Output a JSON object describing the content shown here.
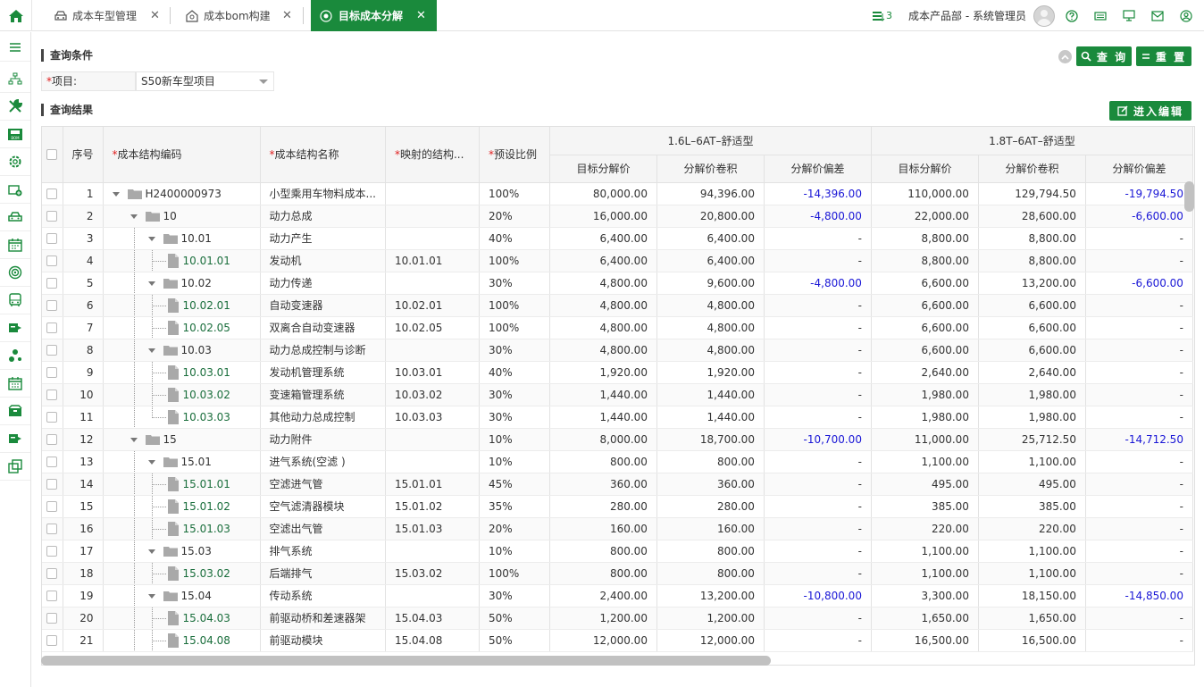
{
  "tabs": [
    {
      "label": "成本车型管理",
      "icon": "car-icon"
    },
    {
      "label": "成本bom构建",
      "icon": "bom-icon"
    },
    {
      "label": "目标成本分解",
      "icon": "target-icon",
      "active": true
    }
  ],
  "tab_close": "✕",
  "header": {
    "badge_count": "3",
    "user_label": "成本产品部 - 系统管理员"
  },
  "query": {
    "section_title": "查询条件",
    "project_label": "项目:",
    "project_required": "*",
    "project_value": "S50新车型项目",
    "query_button": "查 询",
    "reset_button": "重 置"
  },
  "result": {
    "section_title": "查询结果",
    "edit_button": "进入编辑"
  },
  "table": {
    "columns": {
      "seq": "序号",
      "code": "成本结构编码",
      "name": "成本结构名称",
      "mapped": "映射的结构...",
      "ratio": "预设比例",
      "target": "目标分解价",
      "roll": "分解价卷积",
      "dev": "分解价偏差"
    },
    "required_mark": "*",
    "groups": [
      "1.6L–6AT–舒适型",
      "1.8T–6AT–舒适型"
    ],
    "rows": [
      {
        "seq": "1",
        "code": "H2400000973",
        "level": 0,
        "type": "folder",
        "last": true,
        "name": "小型乘用车物料成本...",
        "mapped": "",
        "ratio": "100%",
        "t1": "80,000.00",
        "r1": "94,396.00",
        "d1": "-14,396.00",
        "d1b": true,
        "t2": "110,000.00",
        "r2": "129,794.50",
        "d2": "-19,794.50",
        "d2b": true
      },
      {
        "seq": "2",
        "code": "10",
        "level": 1,
        "type": "folder",
        "last": false,
        "name": "动力总成",
        "mapped": "",
        "ratio": "20%",
        "t1": "16,000.00",
        "r1": "20,800.00",
        "d1": "-4,800.00",
        "d1b": true,
        "t2": "22,000.00",
        "r2": "28,600.00",
        "d2": "-6,600.00",
        "d2b": true
      },
      {
        "seq": "3",
        "code": "10.01",
        "level": 2,
        "type": "folder",
        "last": false,
        "name": "动力产生",
        "mapped": "",
        "ratio": "40%",
        "t1": "6,400.00",
        "r1": "6,400.00",
        "d1": "-",
        "t2": "8,800.00",
        "r2": "8,800.00",
        "d2": "-"
      },
      {
        "seq": "4",
        "code": "10.01.01",
        "level": 3,
        "type": "doc",
        "last": true,
        "name": "发动机",
        "mapped": "10.01.01",
        "ratio": "100%",
        "t1": "6,400.00",
        "r1": "6,400.00",
        "d1": "-",
        "t2": "8,800.00",
        "r2": "8,800.00",
        "d2": "-"
      },
      {
        "seq": "5",
        "code": "10.02",
        "level": 2,
        "type": "folder",
        "last": false,
        "name": "动力传递",
        "mapped": "",
        "ratio": "30%",
        "t1": "4,800.00",
        "r1": "9,600.00",
        "d1": "-4,800.00",
        "d1b": true,
        "t2": "6,600.00",
        "r2": "13,200.00",
        "d2": "-6,600.00",
        "d2b": true
      },
      {
        "seq": "6",
        "code": "10.02.01",
        "level": 3,
        "type": "doc",
        "last": false,
        "name": "自动变速器",
        "mapped": "10.02.01",
        "ratio": "100%",
        "t1": "4,800.00",
        "r1": "4,800.00",
        "d1": "-",
        "t2": "6,600.00",
        "r2": "6,600.00",
        "d2": "-"
      },
      {
        "seq": "7",
        "code": "10.02.05",
        "level": 3,
        "type": "doc",
        "last": true,
        "name": "双离合自动变速器",
        "mapped": "10.02.05",
        "ratio": "100%",
        "t1": "4,800.00",
        "r1": "4,800.00",
        "d1": "-",
        "t2": "6,600.00",
        "r2": "6,600.00",
        "d2": "-"
      },
      {
        "seq": "8",
        "code": "10.03",
        "level": 2,
        "type": "folder",
        "last": true,
        "name": "动力总成控制与诊断",
        "mapped": "",
        "ratio": "30%",
        "t1": "4,800.00",
        "r1": "4,800.00",
        "d1": "-",
        "t2": "6,600.00",
        "r2": "6,600.00",
        "d2": "-"
      },
      {
        "seq": "9",
        "code": "10.03.01",
        "level": 3,
        "type": "doc",
        "last": false,
        "name": "发动机管理系统",
        "mapped": "10.03.01",
        "ratio": "40%",
        "t1": "1,920.00",
        "r1": "1,920.00",
        "d1": "-",
        "t2": "2,640.00",
        "r2": "2,640.00",
        "d2": "-"
      },
      {
        "seq": "10",
        "code": "10.03.02",
        "level": 3,
        "type": "doc",
        "last": false,
        "name": "变速箱管理系统",
        "mapped": "10.03.02",
        "ratio": "30%",
        "t1": "1,440.00",
        "r1": "1,440.00",
        "d1": "-",
        "t2": "1,980.00",
        "r2": "1,980.00",
        "d2": "-"
      },
      {
        "seq": "11",
        "code": "10.03.03",
        "level": 3,
        "type": "doc",
        "last": true,
        "name": "其他动力总成控制",
        "mapped": "10.03.03",
        "ratio": "30%",
        "t1": "1,440.00",
        "r1": "1,440.00",
        "d1": "-",
        "t2": "1,980.00",
        "r2": "1,980.00",
        "d2": "-"
      },
      {
        "seq": "12",
        "code": "15",
        "level": 1,
        "type": "folder",
        "last": false,
        "name": "动力附件",
        "mapped": "",
        "ratio": "10%",
        "t1": "8,000.00",
        "r1": "18,700.00",
        "d1": "-10,700.00",
        "d1b": true,
        "t2": "11,000.00",
        "r2": "25,712.50",
        "d2": "-14,712.50",
        "d2b": true
      },
      {
        "seq": "13",
        "code": "15.01",
        "level": 2,
        "type": "folder",
        "last": false,
        "name": "进气系统(空滤 )",
        "mapped": "",
        "ratio": "10%",
        "t1": "800.00",
        "r1": "800.00",
        "d1": "-",
        "t2": "1,100.00",
        "r2": "1,100.00",
        "d2": "-"
      },
      {
        "seq": "14",
        "code": "15.01.01",
        "level": 3,
        "type": "doc",
        "last": false,
        "name": "空滤进气管",
        "mapped": "15.01.01",
        "ratio": "45%",
        "t1": "360.00",
        "r1": "360.00",
        "d1": "-",
        "t2": "495.00",
        "r2": "495.00",
        "d2": "-"
      },
      {
        "seq": "15",
        "code": "15.01.02",
        "level": 3,
        "type": "doc",
        "last": false,
        "name": "空气滤清器模块",
        "mapped": "15.01.02",
        "ratio": "35%",
        "t1": "280.00",
        "r1": "280.00",
        "d1": "-",
        "t2": "385.00",
        "r2": "385.00",
        "d2": "-"
      },
      {
        "seq": "16",
        "code": "15.01.03",
        "level": 3,
        "type": "doc",
        "last": true,
        "name": "空滤出气管",
        "mapped": "15.01.03",
        "ratio": "20%",
        "t1": "160.00",
        "r1": "160.00",
        "d1": "-",
        "t2": "220.00",
        "r2": "220.00",
        "d2": "-"
      },
      {
        "seq": "17",
        "code": "15.03",
        "level": 2,
        "type": "folder",
        "last": false,
        "name": "排气系统",
        "mapped": "",
        "ratio": "10%",
        "t1": "800.00",
        "r1": "800.00",
        "d1": "-",
        "t2": "1,100.00",
        "r2": "1,100.00",
        "d2": "-"
      },
      {
        "seq": "18",
        "code": "15.03.02",
        "level": 3,
        "type": "doc",
        "last": true,
        "name": "后端排气",
        "mapped": "15.03.02",
        "ratio": "100%",
        "t1": "800.00",
        "r1": "800.00",
        "d1": "-",
        "t2": "1,100.00",
        "r2": "1,100.00",
        "d2": "-"
      },
      {
        "seq": "19",
        "code": "15.04",
        "level": 2,
        "type": "folder",
        "last": false,
        "name": "传动系统",
        "mapped": "",
        "ratio": "30%",
        "t1": "2,400.00",
        "r1": "13,200.00",
        "d1": "-10,800.00",
        "d1b": true,
        "t2": "3,300.00",
        "r2": "18,150.00",
        "d2": "-14,850.00",
        "d2b": true
      },
      {
        "seq": "20",
        "code": "15.04.03",
        "level": 3,
        "type": "doc",
        "last": false,
        "name": "前驱动桥和差速器架",
        "mapped": "15.04.03",
        "ratio": "50%",
        "t1": "1,200.00",
        "r1": "1,200.00",
        "d1": "-",
        "t2": "1,650.00",
        "r2": "1,650.00",
        "d2": "-"
      },
      {
        "seq": "21",
        "code": "15.04.08",
        "level": 3,
        "type": "doc",
        "last": false,
        "name": "前驱动模块",
        "mapped": "15.04.08",
        "ratio": "50%",
        "t1": "12,000.00",
        "r1": "12,000.00",
        "d1": "-",
        "t2": "16,500.00",
        "r2": "16,500.00",
        "d2": "-"
      }
    ]
  },
  "sidebar_icons": [
    "menu-icon",
    "org-tree-icon",
    "tools-icon",
    "bom-icon",
    "settings-icon",
    "add-model-icon",
    "car-icon",
    "calendar-icon",
    "target-icon",
    "bus-icon",
    "tag-icon",
    "share-icon",
    "calendar-check-icon",
    "box-icon",
    "tag-icon",
    "window-icon"
  ],
  "colors": {
    "brand": "#1a8a3c",
    "negative": "#1a17d6",
    "required": "#e02020"
  }
}
